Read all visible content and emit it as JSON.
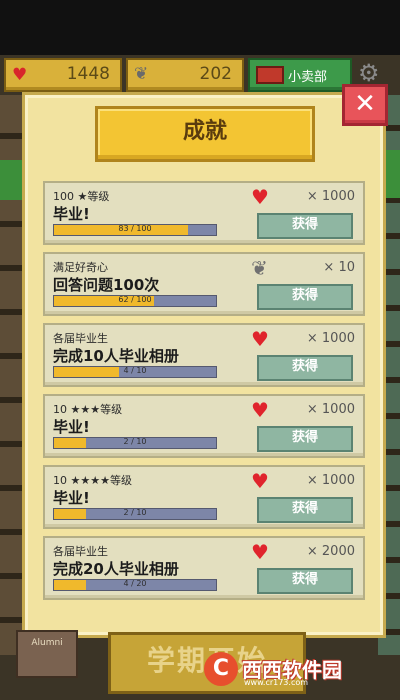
{
  "topbar": {
    "hearts": "1448",
    "feathers": "202",
    "shop_label": "小卖部"
  },
  "panel": {
    "title": "成就",
    "close_label": "✕"
  },
  "achievements": [
    {
      "sub": "100 ★等级",
      "main": "毕业!",
      "progress_text": "83 / 100",
      "progress": 0.83,
      "reward_icon": "heart-icon",
      "reward_amount": "× 1000",
      "button": "获得"
    },
    {
      "sub": "满足好奇心",
      "main": "回答问题100次",
      "progress_text": "62 / 100",
      "progress": 0.62,
      "reward_icon": "feather-icon",
      "reward_amount": "× 10",
      "button": "获得"
    },
    {
      "sub": "各届毕业生",
      "main": "完成10人毕业相册",
      "progress_text": "4 / 10",
      "progress": 0.4,
      "reward_icon": "heart-icon",
      "reward_amount": "× 1000",
      "button": "获得"
    },
    {
      "sub": "10 ★★★等级",
      "main": "毕业!",
      "progress_text": "2 / 10",
      "progress": 0.2,
      "reward_icon": "heart-icon",
      "reward_amount": "× 1000",
      "button": "获得"
    },
    {
      "sub": "10 ★★★★等级",
      "main": "毕业!",
      "progress_text": "2 / 10",
      "progress": 0.2,
      "reward_icon": "heart-icon",
      "reward_amount": "× 1000",
      "button": "获得"
    },
    {
      "sub": "各届毕业生",
      "main": "完成20人毕业相册",
      "progress_text": "4 / 20",
      "progress": 0.2,
      "reward_icon": "heart-icon",
      "reward_amount": "× 2000",
      "button": "获得"
    }
  ],
  "bottom": {
    "start_label": "学期开始",
    "archive_label": "Alumni",
    "watermark_main": "西西软件园",
    "watermark_sub": "www.cr173.com"
  },
  "colors": {
    "heart": "#e0242c",
    "progress_fill": "#f0b92c",
    "progress_track": "#7d86a8",
    "get_button": "#8fb6a2",
    "title_bg": "#f3c533",
    "close_bg": "#e8545a"
  }
}
